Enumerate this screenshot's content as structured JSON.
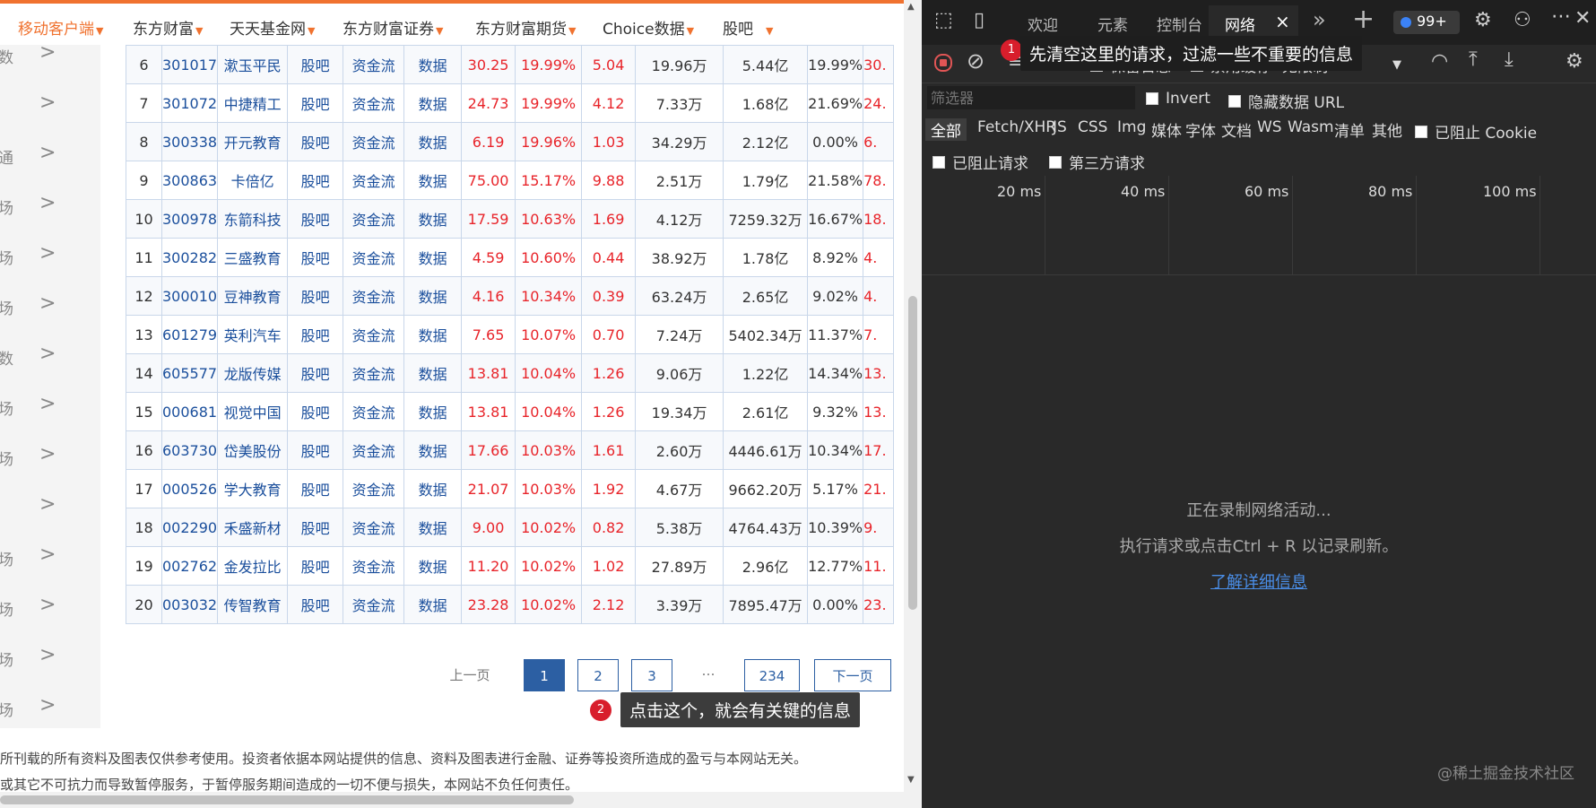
{
  "topnav": [
    {
      "label": "移动客户端"
    },
    {
      "label": "东方财富"
    },
    {
      "label": "天天基金网"
    },
    {
      "label": "东方财富证券"
    },
    {
      "label": "东方财富期货"
    },
    {
      "label": "Choice数据"
    },
    {
      "label": "股吧"
    }
  ],
  "sidebar": [
    {
      "ch": "数",
      "arrow": ">"
    },
    {
      "ch": "",
      "arrow": ">"
    },
    {
      "ch": "通",
      "arrow": ">"
    },
    {
      "ch": "场",
      "arrow": ">"
    },
    {
      "ch": "场",
      "arrow": ">"
    },
    {
      "ch": "场",
      "arrow": ">"
    },
    {
      "ch": "数",
      "arrow": ">"
    },
    {
      "ch": "场",
      "arrow": ">"
    },
    {
      "ch": "场",
      "arrow": ">"
    },
    {
      "ch": "",
      "arrow": ">"
    },
    {
      "ch": "场",
      "arrow": ">"
    },
    {
      "ch": "场",
      "arrow": ">"
    },
    {
      "ch": "场",
      "arrow": ">"
    },
    {
      "ch": "场",
      "arrow": ">"
    }
  ],
  "table": {
    "link_labels": [
      "股吧",
      "资金流",
      "数据"
    ],
    "rows": [
      {
        "idx": "6",
        "code": "301017",
        "name": "漱玉平民",
        "price": "30.25",
        "pct": "19.99%",
        "chg": "5.04",
        "vol": "19.96万",
        "amt": "5.44亿",
        "amp": "19.99%",
        "more": "30."
      },
      {
        "idx": "7",
        "code": "301072",
        "name": "中捷精工",
        "price": "24.73",
        "pct": "19.99%",
        "chg": "4.12",
        "vol": "7.33万",
        "amt": "1.68亿",
        "amp": "21.69%",
        "more": "24."
      },
      {
        "idx": "8",
        "code": "300338",
        "name": "开元教育",
        "price": "6.19",
        "pct": "19.96%",
        "chg": "1.03",
        "vol": "34.29万",
        "amt": "2.12亿",
        "amp": "0.00%",
        "more": "6."
      },
      {
        "idx": "9",
        "code": "300863",
        "name": "卡倍亿",
        "price": "75.00",
        "pct": "15.17%",
        "chg": "9.88",
        "vol": "2.51万",
        "amt": "1.79亿",
        "amp": "21.58%",
        "more": "78."
      },
      {
        "idx": "10",
        "code": "300978",
        "name": "东箭科技",
        "price": "17.59",
        "pct": "10.63%",
        "chg": "1.69",
        "vol": "4.12万",
        "amt": "7259.32万",
        "amp": "16.67%",
        "more": "18."
      },
      {
        "idx": "11",
        "code": "300282",
        "name": "三盛教育",
        "price": "4.59",
        "pct": "10.60%",
        "chg": "0.44",
        "vol": "38.92万",
        "amt": "1.78亿",
        "amp": "8.92%",
        "more": "4."
      },
      {
        "idx": "12",
        "code": "300010",
        "name": "豆神教育",
        "price": "4.16",
        "pct": "10.34%",
        "chg": "0.39",
        "vol": "63.24万",
        "amt": "2.65亿",
        "amp": "9.02%",
        "more": "4."
      },
      {
        "idx": "13",
        "code": "601279",
        "name": "英利汽车",
        "price": "7.65",
        "pct": "10.07%",
        "chg": "0.70",
        "vol": "7.24万",
        "amt": "5402.34万",
        "amp": "11.37%",
        "more": "7."
      },
      {
        "idx": "14",
        "code": "605577",
        "name": "龙版传媒",
        "price": "13.81",
        "pct": "10.04%",
        "chg": "1.26",
        "vol": "9.06万",
        "amt": "1.22亿",
        "amp": "14.34%",
        "more": "13."
      },
      {
        "idx": "15",
        "code": "000681",
        "name": "视觉中国",
        "price": "13.81",
        "pct": "10.04%",
        "chg": "1.26",
        "vol": "19.34万",
        "amt": "2.61亿",
        "amp": "9.32%",
        "more": "13."
      },
      {
        "idx": "16",
        "code": "603730",
        "name": "岱美股份",
        "price": "17.66",
        "pct": "10.03%",
        "chg": "1.61",
        "vol": "2.60万",
        "amt": "4446.61万",
        "amp": "10.34%",
        "more": "17."
      },
      {
        "idx": "17",
        "code": "000526",
        "name": "学大教育",
        "price": "21.07",
        "pct": "10.03%",
        "chg": "1.92",
        "vol": "4.67万",
        "amt": "9662.20万",
        "amp": "5.17%",
        "more": "21."
      },
      {
        "idx": "18",
        "code": "002290",
        "name": "禾盛新材",
        "price": "9.00",
        "pct": "10.02%",
        "chg": "0.82",
        "vol": "5.38万",
        "amt": "4764.43万",
        "amp": "10.39%",
        "more": "9."
      },
      {
        "idx": "19",
        "code": "002762",
        "name": "金发拉比",
        "price": "11.20",
        "pct": "10.02%",
        "chg": "1.02",
        "vol": "27.89万",
        "amt": "2.96亿",
        "amp": "12.77%",
        "more": "11."
      },
      {
        "idx": "20",
        "code": "003032",
        "name": "传智教育",
        "price": "23.28",
        "pct": "10.02%",
        "chg": "2.12",
        "vol": "3.39万",
        "amt": "7895.47万",
        "amp": "0.00%",
        "more": "23."
      }
    ]
  },
  "pager": {
    "prev": "上一页",
    "pages": [
      "1",
      "2",
      "3"
    ],
    "ellipsis": "…",
    "last": "234",
    "next": "下一页"
  },
  "annotations": {
    "badge1": "1",
    "tip1": "先清空这里的请求，过滤一些不重要的信息",
    "badge2": "2",
    "tip2": "点击这个，就会有关键的信息"
  },
  "footer": {
    "line1": "所刊载的所有资料及图表仅供参考使用。投资者依据本网站提供的信息、资料及图表进行金融、证券等投资所造成的盈亏与本网站无关。",
    "line2": "或其它不可抗力而导致暂停服务，于暂停服务期间造成的一切不便与损失，本网站不负任何责任。"
  },
  "devtools": {
    "tabs": [
      "欢迎",
      "元素",
      "控制台",
      "网络"
    ],
    "close_tab": "×",
    "more_tabs": "»",
    "add_tab": "+",
    "issues_badge": "99+",
    "toolbar": {
      "preserve_log": "保留日志",
      "disable_cache": "禁用缓存",
      "throttle": "无限制"
    },
    "filter_placeholder": "筛选器",
    "invert": "Invert",
    "hide_data_url": "隐藏数据 URL",
    "types": [
      "全部",
      "Fetch/XHR",
      "JS",
      "CSS",
      "Img",
      "媒体",
      "字体",
      "文档",
      "WS",
      "Wasm",
      "清单",
      "其他"
    ],
    "blocked_cookies": "已阻止 Cookie",
    "blocked_requests": "已阻止请求",
    "third_party": "第三方请求",
    "ticks": [
      "20 ms",
      "40 ms",
      "60 ms",
      "80 ms",
      "100 ms"
    ],
    "recording": "正在录制网络活动...",
    "hint": "执行请求或点击Ctrl + R 以记录刷新。",
    "learn_more": "了解详细信息"
  },
  "watermark": "@稀土掘金技术社区"
}
